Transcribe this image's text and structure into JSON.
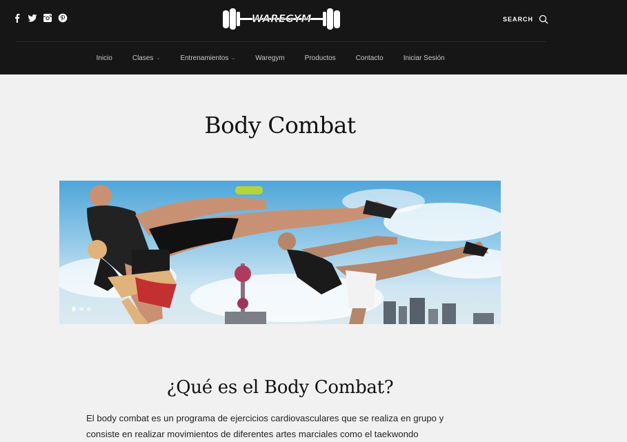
{
  "header": {
    "social": [
      {
        "name": "facebook-icon"
      },
      {
        "name": "twitter-icon"
      },
      {
        "name": "instagram-icon"
      },
      {
        "name": "pinterest-icon"
      }
    ],
    "logo_text": "WAREGYM",
    "search_label": "SEARCH",
    "nav": [
      {
        "label": "Inicio",
        "has_dropdown": false
      },
      {
        "label": "Clases",
        "has_dropdown": true
      },
      {
        "label": "Entrenamientos",
        "has_dropdown": true
      },
      {
        "label": "Waregym",
        "has_dropdown": false
      },
      {
        "label": "Productos",
        "has_dropdown": false
      },
      {
        "label": "Contacto",
        "has_dropdown": false
      },
      {
        "label": "Iniciar Sesión",
        "has_dropdown": false
      }
    ],
    "dropdown_glyph": "⌄"
  },
  "main": {
    "title": "Body Combat",
    "slider": {
      "slides": 3,
      "active": 1
    },
    "section_title": "¿Qué es el Body Combat?",
    "paragraph": "El body combat es un programa de ejercicios cardiovasculares que se realiza en grupo y consiste en realizar movimientos de diferentes artes marciales como el taekwondo"
  },
  "colors": {
    "header_bg": "#161616",
    "page_bg": "#f1f1f1",
    "nav_text": "#c9c9c9"
  }
}
